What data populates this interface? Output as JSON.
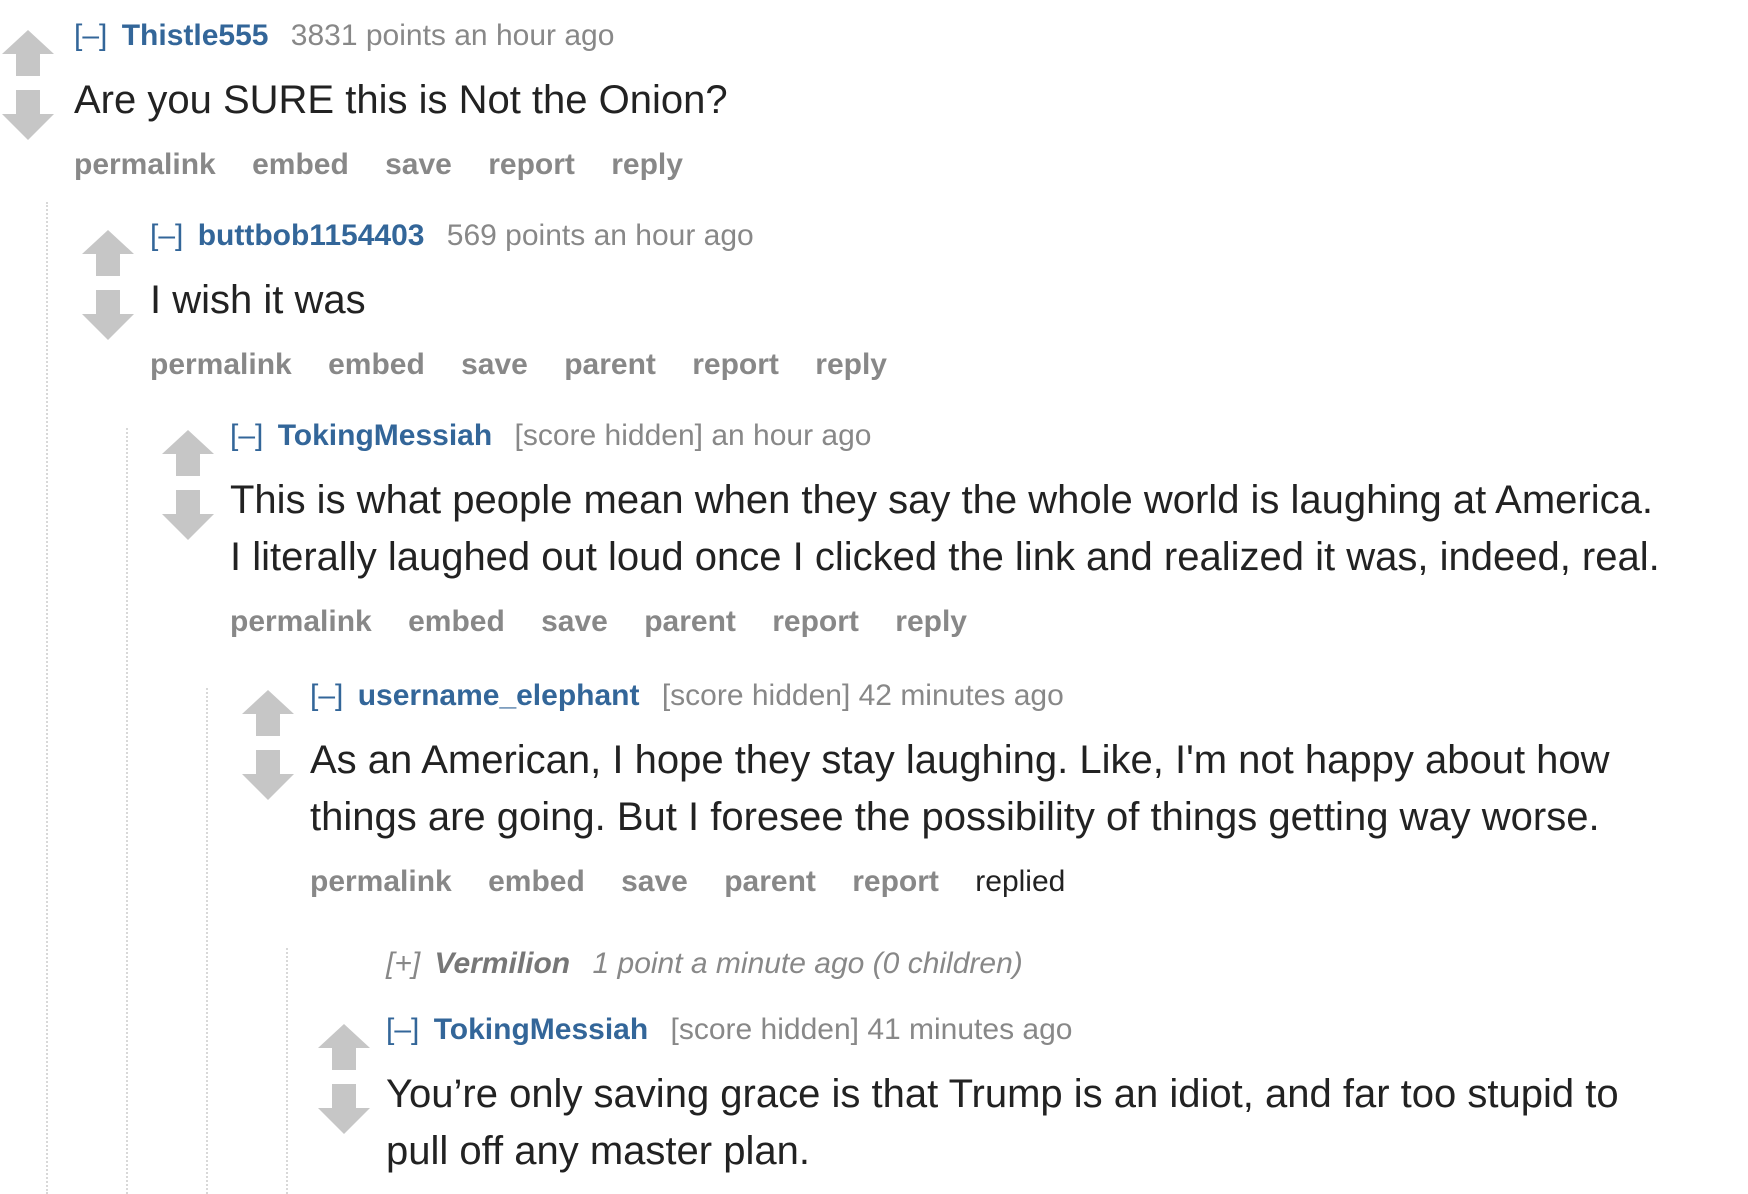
{
  "comments": [
    {
      "toggle": "[–]",
      "author": "Thistle555",
      "meta": "3831 points an hour ago",
      "text": "Are you SURE this is Not the Onion?",
      "actions": [
        "permalink",
        "embed",
        "save",
        "report",
        "reply"
      ]
    },
    {
      "toggle": "[–]",
      "author": "buttbob1154403",
      "meta": "569 points an hour ago",
      "text": "I wish it was",
      "actions": [
        "permalink",
        "embed",
        "save",
        "parent",
        "report",
        "reply"
      ]
    },
    {
      "toggle": "[–]",
      "author": "TokingMessiah",
      "meta": "[score hidden] an hour ago",
      "text_lines": [
        "This is what people mean when they say the whole world is laughing at America.",
        "I literally laughed out loud once I clicked the link and realized it was, indeed, real."
      ],
      "actions": [
        "permalink",
        "embed",
        "save",
        "parent",
        "report",
        "reply"
      ]
    },
    {
      "toggle": "[–]",
      "author": "username_elephant",
      "meta": "[score hidden] 42 minutes ago",
      "text_lines": [
        "As an American, I hope they stay laughing. Like, I'm not happy about how",
        "things are going. But I foresee the possibility of things getting way worse."
      ],
      "actions": [
        "permalink",
        "embed",
        "save",
        "parent",
        "report"
      ],
      "replied_label": "replied"
    },
    {
      "toggle": "[+]",
      "author": "Vermilion",
      "meta": "1 point a minute ago (0 children)",
      "collapsed": true
    },
    {
      "toggle": "[–]",
      "author": "TokingMessiah",
      "meta": "[score hidden] 41 minutes ago",
      "text_lines": [
        "You’re only saving grace is that Trump is an idiot, and far too stupid to",
        "pull off any master plan."
      ]
    }
  ],
  "icons": {
    "upvote": "upvote-arrow-icon",
    "downvote": "downvote-arrow-icon"
  },
  "colors": {
    "author": "#336699",
    "meta": "#888888",
    "text": "#222222",
    "arrow": "#c6c6c6",
    "thread_line": "#d8d8d8"
  }
}
